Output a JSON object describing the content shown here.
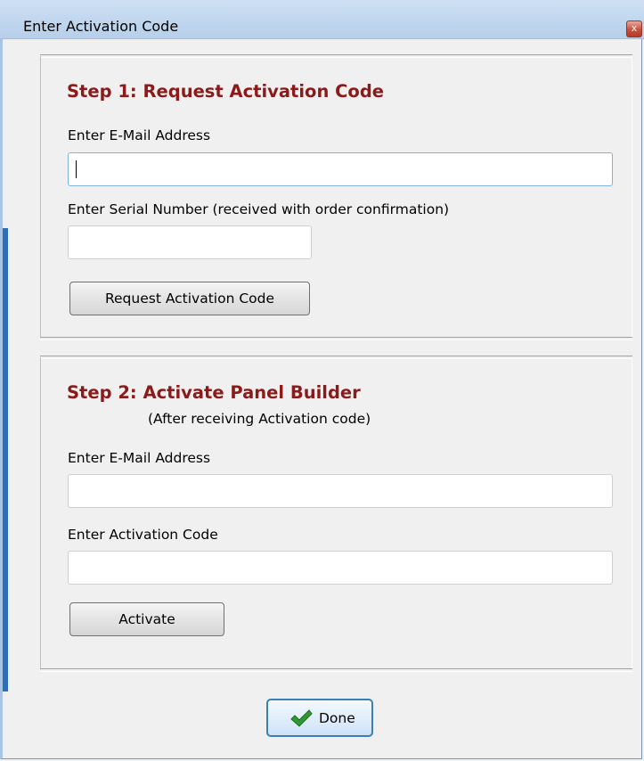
{
  "window": {
    "title": "Enter Activation Code",
    "close_glyph": "x"
  },
  "step1": {
    "title": "Step 1: Request Activation Code",
    "email_label": "Enter E-Mail Address",
    "email_value": "",
    "serial_label": "Enter Serial Number (received with order confirmation)",
    "serial_value": "",
    "request_button": "Request Activation Code"
  },
  "step2": {
    "title": "Step 2: Activate Panel Builder",
    "subtitle": "(After receiving Activation code)",
    "email_label": "Enter E-Mail Address",
    "email_value": "",
    "code_label": "Enter Activation Code",
    "code_value": "",
    "activate_button": "Activate"
  },
  "footer": {
    "done_button": "Done",
    "done_icon": "checkmark-icon",
    "done_icon_color": "#2e9a2e"
  }
}
